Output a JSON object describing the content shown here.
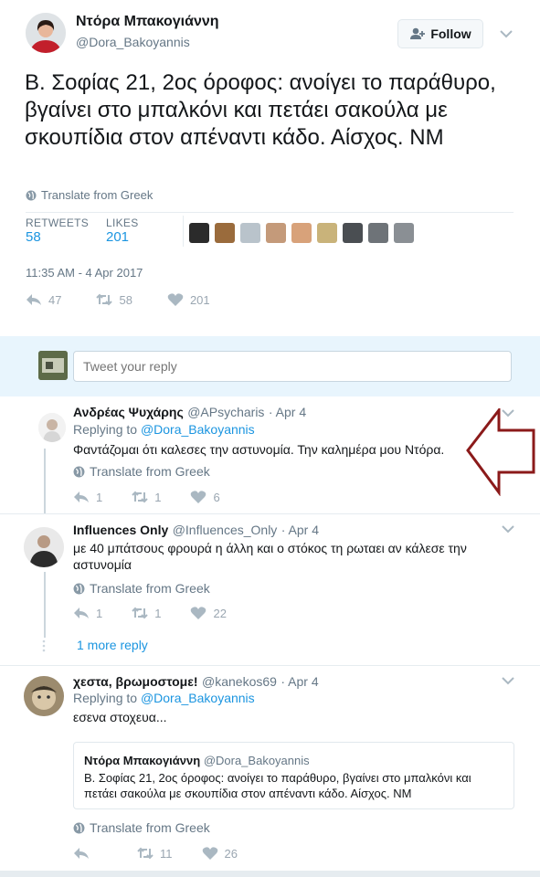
{
  "main": {
    "name": "Ντόρα Μπακογιάννη",
    "handle": "@Dora_Bakoyannis",
    "follow_label": "Follow",
    "text": "Β. Σοφίας 21, 2ος όροφος: ανοίγει το παράθυρο, βγαίνει στο μπαλκόνι και πετάει σακούλα με σκουπίδια στον απέναντι κάδο. Αίσχος. ΝΜ",
    "translate": "Translate from Greek",
    "retweets_label": "RETWEETS",
    "retweets": "58",
    "likes_label": "LIKES",
    "likes": "201",
    "timestamp": "11:35 AM - 4 Apr 2017",
    "actions": {
      "replies": "47",
      "retweets": "58",
      "likes": "201"
    }
  },
  "reply_box": {
    "placeholder": "Tweet your reply"
  },
  "replies": [
    {
      "name": "Ανδρέας Ψυχάρης",
      "handle": "@APsycharis",
      "date": "· Apr 4",
      "replying_prefix": "Replying to",
      "replying_to": "@Dora_Bakoyannis",
      "text": "Φαντάζομαι ότι καλεσες την αστυνομία.  Την καλημέρα μου Ντόρα.",
      "translate": "Translate from Greek",
      "replies": "1",
      "retweets": "1",
      "likes": "6"
    },
    {
      "name": "Influences Only",
      "handle": "@Influences_Only",
      "date": "· Apr 4",
      "text": "με 40 μπάτσους φρουρά η άλλη και ο στόκος τη ρωταει αν κάλεσε την αστυνομία",
      "translate": "Translate from Greek",
      "replies": "1",
      "retweets": "1",
      "likes": "22",
      "more_replies": "1 more reply"
    },
    {
      "name": "χεστα, βρωμοστομε!",
      "handle": "@kanekos69",
      "date": "· Apr 4",
      "replying_prefix": "Replying to",
      "replying_to": "@Dora_Bakoyannis",
      "text": "εσενα στοχευα...",
      "quote": {
        "name": "Ντόρα Μπακογιάννη",
        "handle": "@Dora_Bakoyannis",
        "text": "Β. Σοφίας 21, 2ος όροφος: ανοίγει το παράθυρο, βγαίνει στο μπαλκόνι και πετάει σακούλα με σκουπίδια στον απέναντι κάδο. Αίσχος. ΝΜ"
      },
      "translate": "Translate from Greek",
      "retweets": "11",
      "likes": "26"
    }
  ],
  "colors": {
    "link": "#1b95e0",
    "muted": "#657786",
    "arrow": "#8b1a1a"
  }
}
